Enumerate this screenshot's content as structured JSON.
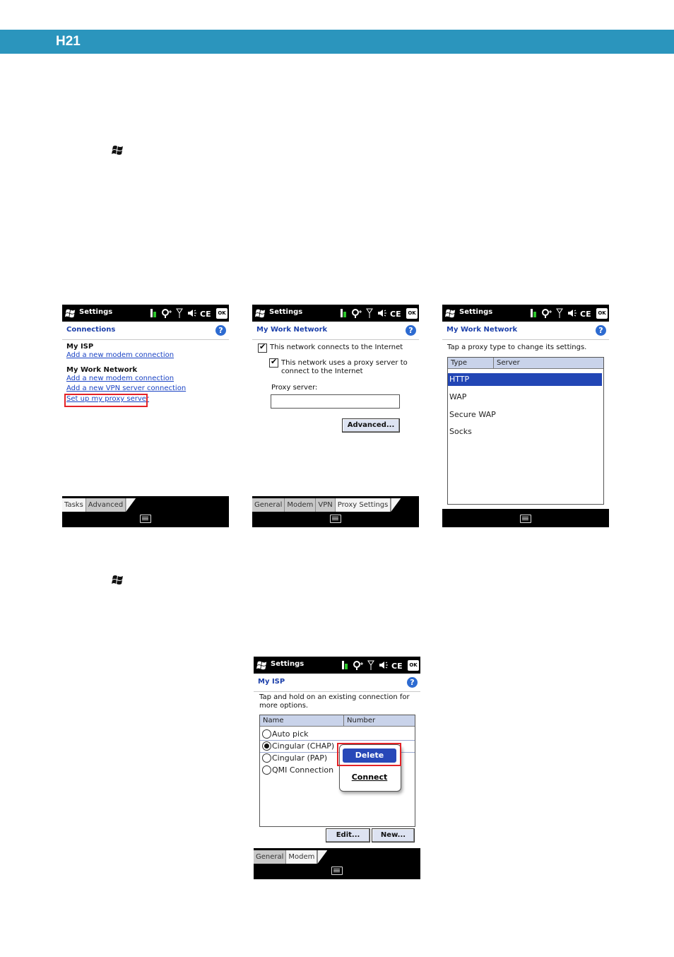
{
  "document": {
    "header_label": "H21"
  },
  "screens": [
    {
      "statusbar": {
        "title": "Settings",
        "ok": "OK"
      },
      "header": {
        "title": "Connections"
      },
      "content": {
        "isp_title": "My ISP",
        "isp_link": "Add a new modem connection",
        "work_title": "My Work Network",
        "work_link1": "Add a new modem connection",
        "work_link2": "Add a new VPN server connection",
        "work_link3": "Set up my proxy server"
      },
      "tabs": [
        "Tasks",
        "Advanced"
      ]
    },
    {
      "statusbar": {
        "title": "Settings",
        "ok": "OK"
      },
      "header": {
        "title": "My Work Network"
      },
      "content": {
        "check1": "This network connects to the Internet",
        "check2_line1": "This network uses a proxy server to",
        "check2_line2": "connect to the Internet",
        "proxy_label": "Proxy server:",
        "proxy_value": "",
        "advanced_button": "Advanced..."
      },
      "tabs": [
        "General",
        "Modem",
        "VPN",
        "Proxy Settings"
      ]
    },
    {
      "statusbar": {
        "title": "Settings",
        "ok": "OK"
      },
      "header": {
        "title": "My Work Network"
      },
      "content": {
        "instruction": "Tap a proxy type to change its settings.",
        "columns": [
          "Type",
          "Server"
        ],
        "rows": [
          "HTTP",
          "WAP",
          "Secure WAP",
          "Socks"
        ],
        "selected_row": "HTTP"
      }
    },
    {
      "statusbar": {
        "title": "Settings",
        "ok": "OK"
      },
      "header": {
        "title": "My ISP"
      },
      "content": {
        "instruction_line1": "Tap and hold on an existing connection for",
        "instruction_line2": "more options.",
        "columns": [
          "Name",
          "Number"
        ],
        "rows": [
          "Auto pick",
          "Cingular (CHAP)",
          "Cingular (PAP)",
          "QMI Connection"
        ],
        "selected_row": "Cingular (CHAP)",
        "menu": [
          "Delete",
          "Connect"
        ],
        "edit_button": "Edit...",
        "new_button": "New..."
      },
      "tabs": [
        "General",
        "Modem"
      ]
    }
  ],
  "colors": {
    "header_band": "#2b95bd",
    "link": "#1a43c4",
    "highlight": "#2246b5",
    "callout": "#e32227"
  }
}
